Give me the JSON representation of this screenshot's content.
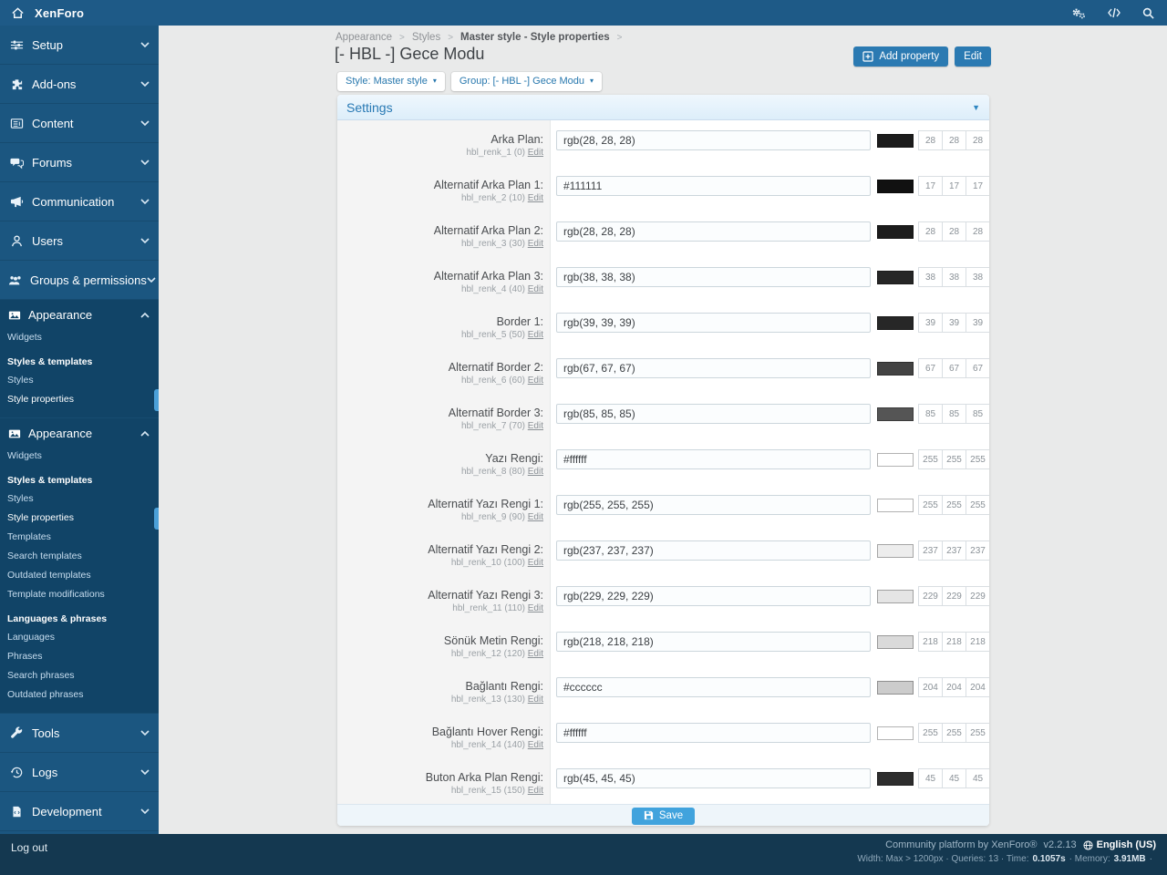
{
  "topbar": {
    "brand": "XenForo"
  },
  "sidebar": {
    "nav_top": [
      {
        "label": "Setup",
        "icon": "sliders-icon"
      },
      {
        "label": "Add-ons",
        "icon": "puzzle-icon"
      },
      {
        "label": "Content",
        "icon": "newspaper-icon"
      },
      {
        "label": "Forums",
        "icon": "chat-bubbles-icon"
      },
      {
        "label": "Communication",
        "icon": "megaphone-icon"
      },
      {
        "label": "Users",
        "icon": "user-icon"
      },
      {
        "label": "Groups & permissions",
        "icon": "users-group-icon"
      }
    ],
    "sections": [
      {
        "title": "Appearance",
        "icon": "image-icon",
        "items": [
          {
            "label": "Widgets",
            "type": "link"
          },
          {
            "label": "Styles & templates",
            "type": "heading"
          },
          {
            "label": "Styles",
            "type": "link"
          },
          {
            "label": "Style properties",
            "type": "link",
            "active": true
          }
        ]
      },
      {
        "title": "Appearance",
        "icon": "image-icon",
        "items": [
          {
            "label": "Widgets",
            "type": "link"
          },
          {
            "label": "Styles & templates",
            "type": "heading"
          },
          {
            "label": "Styles",
            "type": "link"
          },
          {
            "label": "Style properties",
            "type": "link",
            "active": true
          },
          {
            "label": "Templates",
            "type": "link"
          },
          {
            "label": "Search templates",
            "type": "link"
          },
          {
            "label": "Outdated templates",
            "type": "link"
          },
          {
            "label": "Template modifications",
            "type": "link"
          },
          {
            "label": "Languages & phrases",
            "type": "heading"
          },
          {
            "label": "Languages",
            "type": "link"
          },
          {
            "label": "Phrases",
            "type": "link"
          },
          {
            "label": "Search phrases",
            "type": "link"
          },
          {
            "label": "Outdated phrases",
            "type": "link"
          }
        ]
      }
    ],
    "nav_bottom": [
      {
        "label": "Tools",
        "icon": "wrench-icon"
      },
      {
        "label": "Logs",
        "icon": "history-icon"
      },
      {
        "label": "Development",
        "icon": "file-code-icon"
      }
    ]
  },
  "main": {
    "breadcrumb": {
      "items": [
        "Appearance",
        "Styles"
      ],
      "current": "Master style - Style properties"
    },
    "title": "[- HBL -] Gece Modu",
    "actions": {
      "add_property": "Add property",
      "edit": "Edit"
    },
    "filters": {
      "style": "Style: Master style",
      "group": "Group: [- HBL -] Gece Modu"
    },
    "settings": {
      "header": "Settings",
      "edit_label": "Edit",
      "save_label": "Save",
      "rows": [
        {
          "label": "Arka Plan:",
          "code": "hbl_renk_1 (0)",
          "value": "rgb(28, 28, 28)",
          "swatch": "#1c1c1c",
          "rgb": [
            "28",
            "28",
            "28"
          ]
        },
        {
          "label": "Alternatif Arka Plan 1:",
          "code": "hbl_renk_2 (10)",
          "value": "#111111",
          "swatch": "#111111",
          "rgb": [
            "17",
            "17",
            "17"
          ]
        },
        {
          "label": "Alternatif Arka Plan 2:",
          "code": "hbl_renk_3 (30)",
          "value": "rgb(28, 28, 28)",
          "swatch": "#1c1c1c",
          "rgb": [
            "28",
            "28",
            "28"
          ]
        },
        {
          "label": "Alternatif Arka Plan 3:",
          "code": "hbl_renk_4 (40)",
          "value": "rgb(38, 38, 38)",
          "swatch": "#262626",
          "rgb": [
            "38",
            "38",
            "38"
          ]
        },
        {
          "label": "Border 1:",
          "code": "hbl_renk_5 (50)",
          "value": "rgb(39, 39, 39)",
          "swatch": "#272727",
          "rgb": [
            "39",
            "39",
            "39"
          ]
        },
        {
          "label": "Alternatif Border 2:",
          "code": "hbl_renk_6 (60)",
          "value": "rgb(67, 67, 67)",
          "swatch": "#434343",
          "rgb": [
            "67",
            "67",
            "67"
          ]
        },
        {
          "label": "Alternatif Border 3:",
          "code": "hbl_renk_7 (70)",
          "value": "rgb(85, 85, 85)",
          "swatch": "#555555",
          "rgb": [
            "85",
            "85",
            "85"
          ]
        },
        {
          "label": "Yazı Rengi:",
          "code": "hbl_renk_8 (80)",
          "value": "#ffffff",
          "swatch": "#ffffff",
          "rgb": [
            "255",
            "255",
            "255"
          ]
        },
        {
          "label": "Alternatif Yazı Rengi 1:",
          "code": "hbl_renk_9 (90)",
          "value": "rgb(255, 255, 255)",
          "swatch": "#ffffff",
          "rgb": [
            "255",
            "255",
            "255"
          ]
        },
        {
          "label": "Alternatif Yazı Rengi 2:",
          "code": "hbl_renk_10 (100)",
          "value": "rgb(237, 237, 237)",
          "swatch": "#ededed",
          "rgb": [
            "237",
            "237",
            "237"
          ]
        },
        {
          "label": "Alternatif Yazı Rengi 3:",
          "code": "hbl_renk_11 (110)",
          "value": "rgb(229, 229, 229)",
          "swatch": "#e5e5e5",
          "rgb": [
            "229",
            "229",
            "229"
          ]
        },
        {
          "label": "Sönük Metin Rengi:",
          "code": "hbl_renk_12 (120)",
          "value": "rgb(218, 218, 218)",
          "swatch": "#dadada",
          "rgb": [
            "218",
            "218",
            "218"
          ]
        },
        {
          "label": "Bağlantı Rengi:",
          "code": "hbl_renk_13 (130)",
          "value": "#cccccc",
          "swatch": "#cccccc",
          "rgb": [
            "204",
            "204",
            "204"
          ]
        },
        {
          "label": "Bağlantı Hover Rengi:",
          "code": "hbl_renk_14 (140)",
          "value": "#ffffff",
          "swatch": "#ffffff",
          "rgb": [
            "255",
            "255",
            "255"
          ]
        },
        {
          "label": "Buton Arka Plan Rengi:",
          "code": "hbl_renk_15 (150)",
          "value": "rgb(45, 45, 45)",
          "swatch": "#2d2d2d",
          "rgb": [
            "45",
            "45",
            "45"
          ]
        }
      ]
    }
  },
  "footer": {
    "logout": "Log out",
    "platform": "Community platform by XenForo®",
    "version": "v2.2.13",
    "language": "English (US)",
    "stats_prefix": "Width: Max > 1200px · Queries: 13 · Time:",
    "time": "0.1057s",
    "memory_label": "· Memory:",
    "memory": "3.91MB",
    "trail_dot": "·"
  },
  "colors": {
    "topbar": "#1e5a87",
    "sidebar": "#1b5680",
    "sidebar_section": "#114467",
    "footer": "#143850",
    "accent_blue": "#2b7ab2",
    "save_blue": "#41a3dd",
    "active_indicator": "#4ba0d8"
  }
}
